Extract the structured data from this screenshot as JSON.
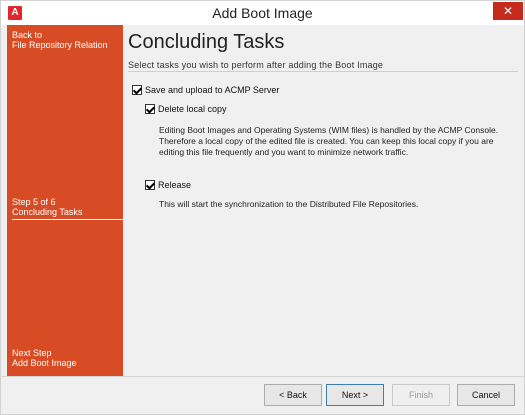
{
  "window": {
    "title": "Add Boot Image",
    "app_icon_letter": "A",
    "close_symbol": "✕"
  },
  "sidebar": {
    "back_line1": "Back to",
    "back_line2": "File Repository Relation",
    "step_line1": "Step 5 of 6",
    "step_line2": "Concluding Tasks",
    "next_line1": "Next Step",
    "next_line2": "Add Boot Image"
  },
  "main": {
    "title": "Concluding Tasks",
    "subtitle": "Select tasks you wish to perform after adding the Boot Image",
    "options": [
      {
        "label": "Save and upload to ACMP Server",
        "checked": true
      },
      {
        "label": "Delete local copy",
        "checked": true
      },
      {
        "label": "Release",
        "checked": true
      }
    ],
    "delete_desc1": "Editing Boot Images and Operating Systems (WIM files) is handled by the ACMP Console.",
    "delete_desc2": "Therefore a local copy of the edited file is created. You can keep this local copy if you are",
    "delete_desc3": "editing this file frequently and you want to minimize network traffic.",
    "release_desc": "This will start the synchronization to the Distributed File Repositories."
  },
  "buttons": {
    "back": "< Back",
    "next": "Next >",
    "finish": "Finish",
    "cancel": "Cancel"
  },
  "colors": {
    "accent": "#d84c25",
    "close": "#c42b1c"
  }
}
